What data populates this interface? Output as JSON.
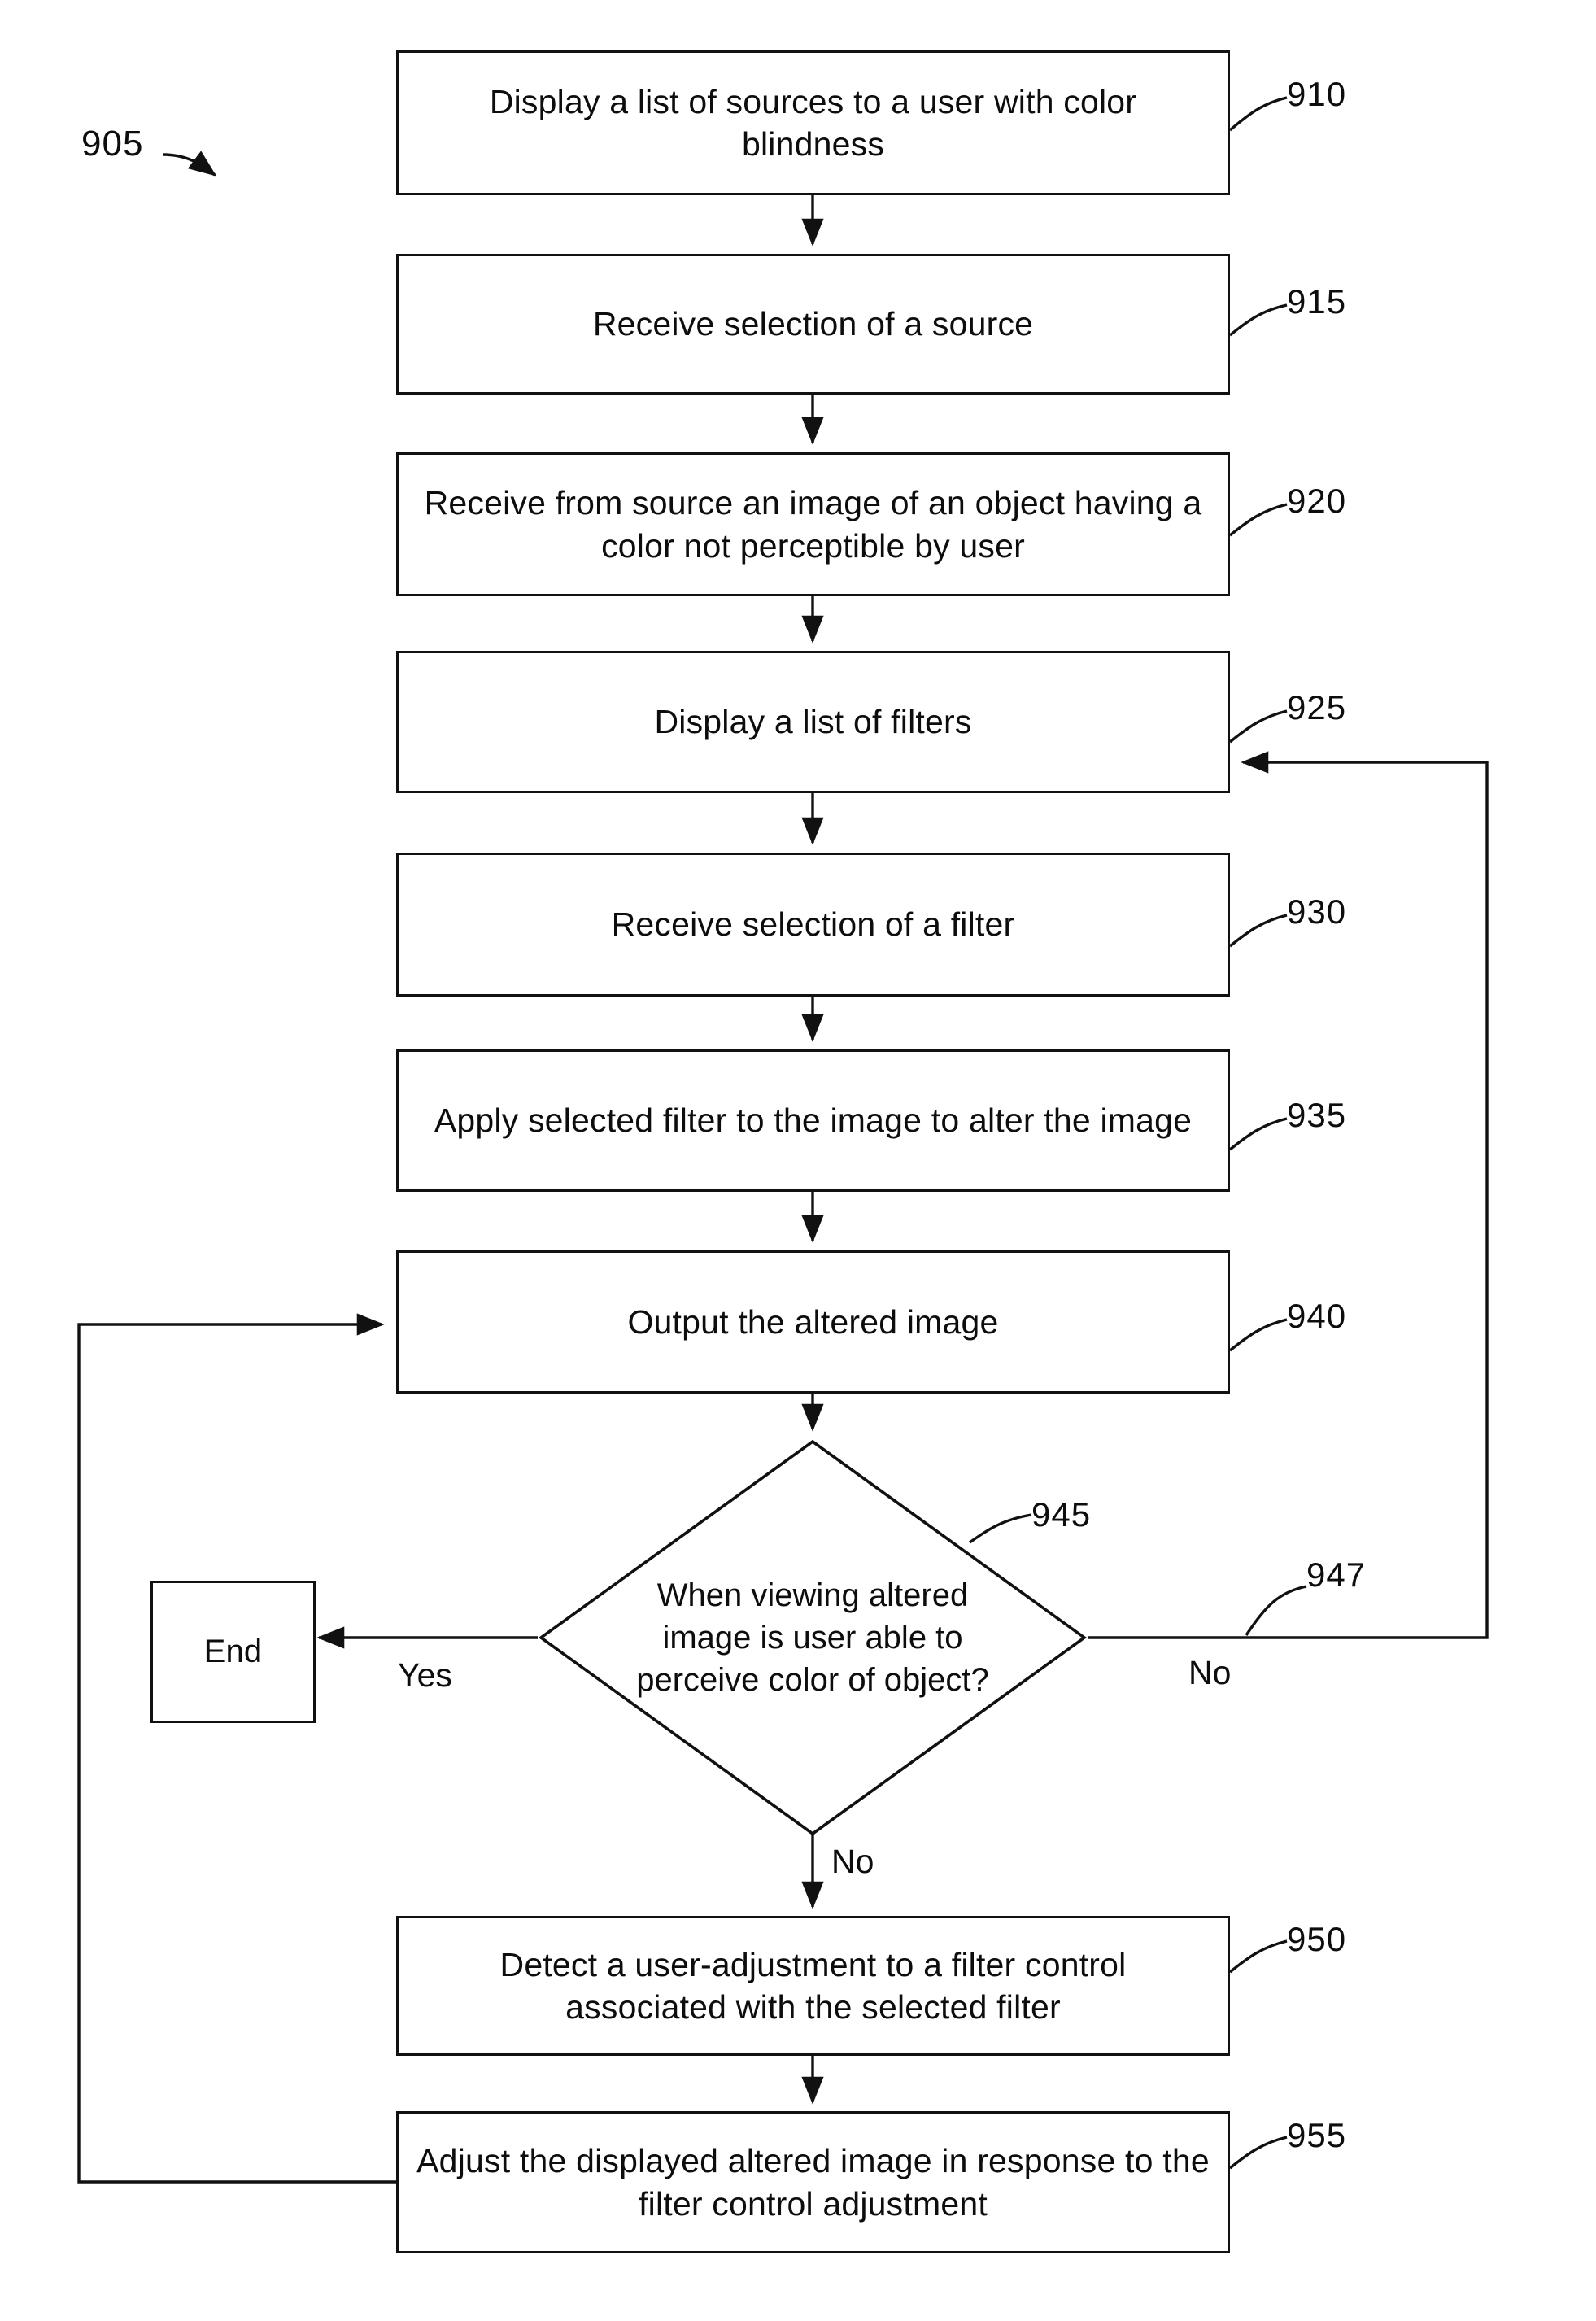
{
  "figure": {
    "id_label": "905"
  },
  "nodes": [
    {
      "id": "910",
      "ref": "910",
      "text": "Display a list of sources to a user with color blindness",
      "shape": "process"
    },
    {
      "id": "915",
      "ref": "915",
      "text": "Receive selection of a source",
      "shape": "process"
    },
    {
      "id": "920",
      "ref": "920",
      "text": "Receive from source an image of an object having a color not perceptible by user",
      "shape": "process"
    },
    {
      "id": "925",
      "ref": "925",
      "text": "Display a list of filters",
      "shape": "process"
    },
    {
      "id": "930",
      "ref": "930",
      "text": "Receive selection of a filter",
      "shape": "process"
    },
    {
      "id": "935",
      "ref": "935",
      "text": "Apply selected filter to the image to alter the image",
      "shape": "process"
    },
    {
      "id": "940",
      "ref": "940",
      "text": "Output the altered image",
      "shape": "process"
    },
    {
      "id": "945",
      "ref": "945",
      "text": "When viewing altered image is user able to perceive color of object?",
      "shape": "decision"
    },
    {
      "id": "end",
      "ref": "",
      "text": "End",
      "shape": "terminator"
    },
    {
      "id": "950",
      "ref": "950",
      "text": "Detect a user-adjustment to a filter control associated with the selected filter",
      "shape": "process"
    },
    {
      "id": "955",
      "ref": "955",
      "text": "Adjust the displayed altered image in response to the filter control adjustment",
      "shape": "process"
    }
  ],
  "edge_labels": {
    "yes": "Yes",
    "no_right": "No",
    "no_bottom": "No",
    "no_right_ref": "947"
  }
}
